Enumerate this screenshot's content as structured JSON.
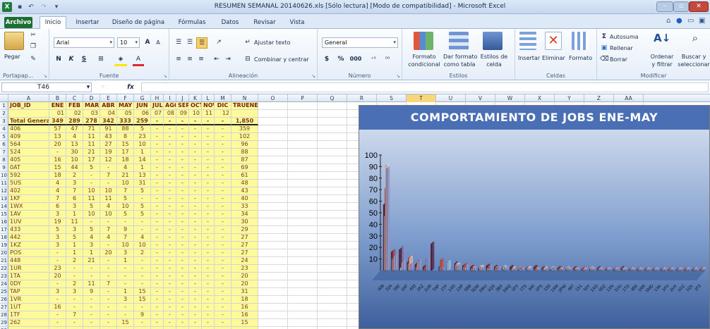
{
  "window": {
    "title": "RESUMEN SEMANAL 20140626.xls  [Sólo lectura]  [Modo de compatibilidad]  -  Microsoft Excel",
    "app_icon": "X"
  },
  "tabs": [
    "Archivo",
    "Inicio",
    "Insertar",
    "Diseño de página",
    "Fórmulas",
    "Datos",
    "Revisar",
    "Vista"
  ],
  "ribbon": {
    "portapapeles": {
      "label": "Portapap...",
      "paste": "Pegar"
    },
    "fuente": {
      "label": "Fuente",
      "font": "Arial",
      "size": "10",
      "bold": "N",
      "italic": "K",
      "underline": "S"
    },
    "alineacion": {
      "label": "Alineación",
      "wrap": "Ajustar texto",
      "merge": "Combinar y centrar"
    },
    "numero": {
      "label": "Número",
      "format": "General",
      "currency": "$",
      "percent": "%",
      "thousands": "000"
    },
    "estilos": {
      "label": "Estilos",
      "cond": [
        "Formato",
        "condicional"
      ],
      "table": [
        "Dar formato",
        "como tabla"
      ],
      "cell": [
        "Estilos de",
        "celda"
      ]
    },
    "celdas": {
      "label": "Celdas",
      "insert": "Insertar",
      "delete": "Eliminar",
      "format": "Formato"
    },
    "modificar": {
      "label": "Modificar",
      "autosum": "Autosuma",
      "fill": "Rellenar",
      "clear": "Borrar",
      "sort": [
        "Ordenar",
        "y filtrar"
      ],
      "find": [
        "Buscar y",
        "seleccionar"
      ]
    }
  },
  "formula_bar": {
    "name_box": "T46",
    "fx": "fx",
    "value": ""
  },
  "columns": [
    "A",
    "B",
    "C",
    "D",
    "E",
    "F",
    "G",
    "H",
    "I",
    "J",
    "K",
    "L",
    "M",
    "N",
    "O",
    "P",
    "Q",
    "R",
    "S",
    "T",
    "U",
    "V",
    "W",
    "X",
    "Y",
    "Z",
    "AA"
  ],
  "selected_column": "T",
  "header_row": [
    "JOB_ID",
    "ENE",
    "FEB",
    "MAR",
    "ABR",
    "MAY",
    "JUN",
    "JUL",
    "AGO",
    "SEP",
    "OCT",
    "NOV",
    "DIC",
    "TRUENE"
  ],
  "week_row": [
    "",
    "01",
    "02",
    "03",
    "04",
    "05",
    "06",
    "07",
    "08",
    "09",
    "10",
    "11",
    "12",
    ""
  ],
  "total_row": [
    "Total General",
    "349",
    "289",
    "278",
    "342",
    "333",
    "259",
    "-",
    "-",
    "-",
    "-",
    "-",
    "-",
    "1,850"
  ],
  "rows": [
    [
      "406",
      "57",
      "47",
      "71",
      "91",
      "88",
      "5",
      "-",
      "-",
      "-",
      "-",
      "-",
      "-",
      "359"
    ],
    [
      "409",
      "13",
      "4",
      "11",
      "43",
      "8",
      "23",
      "-",
      "-",
      "-",
      "-",
      "-",
      "-",
      "102"
    ],
    [
      "564",
      "20",
      "13",
      "11",
      "27",
      "15",
      "10",
      "-",
      "-",
      "-",
      "-",
      "-",
      "-",
      "96"
    ],
    [
      "524",
      "-",
      "30",
      "21",
      "19",
      "17",
      "1",
      "-",
      "-",
      "-",
      "-",
      "-",
      "-",
      "88"
    ],
    [
      "405",
      "16",
      "10",
      "17",
      "12",
      "18",
      "14",
      "-",
      "-",
      "-",
      "-",
      "-",
      "-",
      "87"
    ],
    [
      "0AT",
      "15",
      "44",
      "5",
      "-",
      "4",
      "1",
      "-",
      "-",
      "-",
      "-",
      "-",
      "-",
      "69"
    ],
    [
      "592",
      "18",
      "2",
      "-",
      "7",
      "21",
      "13",
      "-",
      "-",
      "-",
      "-",
      "-",
      "-",
      "61"
    ],
    [
      "5US",
      "4",
      "3",
      "-",
      "-",
      "10",
      "31",
      "-",
      "-",
      "-",
      "-",
      "-",
      "-",
      "48"
    ],
    [
      "402",
      "4",
      "7",
      "10",
      "10",
      "7",
      "5",
      "-",
      "-",
      "-",
      "-",
      "-",
      "-",
      "43"
    ],
    [
      "1KF",
      "7",
      "6",
      "11",
      "11",
      "5",
      "-",
      "-",
      "-",
      "-",
      "-",
      "-",
      "-",
      "40"
    ],
    [
      "1WX",
      "6",
      "3",
      "5",
      "4",
      "10",
      "5",
      "-",
      "-",
      "-",
      "-",
      "-",
      "-",
      "33"
    ],
    [
      "1AV",
      "3",
      "1",
      "10",
      "10",
      "5",
      "5",
      "-",
      "-",
      "-",
      "-",
      "-",
      "-",
      "34"
    ],
    [
      "1UV",
      "19",
      "11",
      "-",
      "-",
      "-",
      "-",
      "-",
      "-",
      "-",
      "-",
      "-",
      "-",
      "30"
    ],
    [
      "433",
      "5",
      "3",
      "5",
      "7",
      "9",
      "-",
      "-",
      "-",
      "-",
      "-",
      "-",
      "-",
      "29"
    ],
    [
      "442",
      "3",
      "5",
      "4",
      "4",
      "7",
      "4",
      "-",
      "-",
      "-",
      "-",
      "-",
      "-",
      "27"
    ],
    [
      "1KZ",
      "3",
      "1",
      "3",
      "-",
      "10",
      "10",
      "-",
      "-",
      "-",
      "-",
      "-",
      "-",
      "27"
    ],
    [
      "POS",
      "-",
      "1",
      "1",
      "20",
      "3",
      "2",
      "-",
      "-",
      "-",
      "-",
      "-",
      "-",
      "27"
    ],
    [
      "448",
      "-",
      "2",
      "21",
      "-",
      "1",
      "-",
      "-",
      "-",
      "-",
      "-",
      "-",
      "-",
      "24"
    ],
    [
      "1UR",
      "23",
      "-",
      "-",
      "-",
      "-",
      "-",
      "-",
      "-",
      "-",
      "-",
      "-",
      "-",
      "23"
    ],
    [
      "1TA",
      "20",
      "-",
      "-",
      "-",
      "-",
      "-",
      "-",
      "-",
      "-",
      "-",
      "-",
      "-",
      "20"
    ],
    [
      "0DY",
      "-",
      "2",
      "11",
      "7",
      "-",
      "-",
      "-",
      "-",
      "-",
      "-",
      "-",
      "-",
      "20"
    ],
    [
      "TAP",
      "3",
      "3",
      "9",
      "-",
      "1",
      "15",
      "-",
      "-",
      "-",
      "-",
      "-",
      "-",
      "31"
    ],
    [
      "1VR",
      "-",
      "-",
      "-",
      "-",
      "3",
      "15",
      "-",
      "-",
      "-",
      "-",
      "-",
      "-",
      "18"
    ],
    [
      "1UT",
      "16",
      "-",
      "-",
      "-",
      "-",
      "-",
      "-",
      "-",
      "-",
      "-",
      "-",
      "-",
      "16"
    ],
    [
      "1TF",
      "-",
      "7",
      "-",
      "-",
      "-",
      "9",
      "-",
      "-",
      "-",
      "-",
      "-",
      "-",
      "16"
    ],
    [
      "262",
      "-",
      "-",
      "-",
      "-",
      "15",
      "-",
      "-",
      "-",
      "-",
      "-",
      "-",
      "-",
      "15"
    ]
  ],
  "chart_data": {
    "type": "bar",
    "title": "COMPORTAMIENTO DE JOBS ENE-MAY",
    "ylim": [
      0,
      100
    ],
    "yticks": [
      10,
      20,
      30,
      40,
      50,
      60,
      70,
      80,
      90,
      100
    ],
    "categories": [
      "406",
      "524",
      "592",
      "1KF",
      "433",
      "1KZ",
      "1UR",
      "TAP",
      "1TF",
      "1XD",
      "1XP",
      "5BB",
      "5DM",
      "1WU",
      "1QS",
      "3BY",
      "1WQ",
      "1PY",
      "1TS",
      "440",
      "1PS",
      "1S9",
      "1SM",
      "2PW",
      "487",
      "1S1",
      "10Y",
      "1XO",
      "0DZ",
      "1XN",
      "1UU",
      "1TD",
      "4B0",
      "1RR",
      "5MD",
      "1SK",
      "1PV",
      "2HY",
      "1CC",
      "1Q1",
      "1F3"
    ],
    "series": [
      {
        "name": "ENE",
        "values": [
          57,
          16,
          18,
          7,
          5,
          3,
          23,
          3,
          0,
          6,
          4,
          3,
          2,
          4,
          3,
          2,
          3,
          1,
          2,
          3,
          2,
          1,
          2,
          1,
          2,
          1,
          1,
          2,
          1,
          1,
          2,
          1,
          1,
          1,
          1,
          1,
          1,
          1,
          1,
          1,
          1
        ]
      },
      {
        "name": "FEB",
        "values": [
          47,
          10,
          2,
          6,
          3,
          1,
          0,
          3,
          7,
          5,
          3,
          2,
          3,
          2,
          2,
          3,
          1,
          2,
          2,
          1,
          1,
          2,
          1,
          2,
          1,
          1,
          2,
          1,
          1,
          1,
          1,
          1,
          1,
          1,
          1,
          1,
          1,
          1,
          1,
          1,
          1
        ]
      },
      {
        "name": "MAR",
        "values": [
          71,
          17,
          0,
          11,
          5,
          3,
          0,
          9,
          0,
          4,
          5,
          3,
          2,
          3,
          2,
          1,
          2,
          2,
          1,
          2,
          1,
          1,
          2,
          1,
          1,
          2,
          1,
          1,
          1,
          1,
          1,
          1,
          1,
          1,
          1,
          1,
          1,
          1,
          1,
          1,
          1
        ]
      },
      {
        "name": "ABR",
        "values": [
          91,
          12,
          7,
          11,
          7,
          0,
          0,
          0,
          0,
          5,
          3,
          2,
          3,
          2,
          1,
          2,
          2,
          1,
          2,
          1,
          2,
          1,
          1,
          1,
          1,
          1,
          1,
          1,
          1,
          1,
          1,
          1,
          1,
          1,
          1,
          1,
          1,
          1,
          1,
          1,
          1
        ]
      },
      {
        "name": "MAY",
        "values": [
          88,
          18,
          21,
          5,
          9,
          10,
          0,
          1,
          0,
          4,
          4,
          2,
          2,
          3,
          2,
          2,
          1,
          2,
          1,
          1,
          1,
          2,
          1,
          1,
          1,
          1,
          1,
          1,
          1,
          1,
          1,
          1,
          1,
          1,
          1,
          1,
          1,
          1,
          1,
          1,
          1
        ]
      }
    ],
    "colors": [
      "#5a1a3a",
      "#a7c6dd",
      "#c84a3a",
      "#e9c7c2",
      "#8a8fc8"
    ]
  }
}
